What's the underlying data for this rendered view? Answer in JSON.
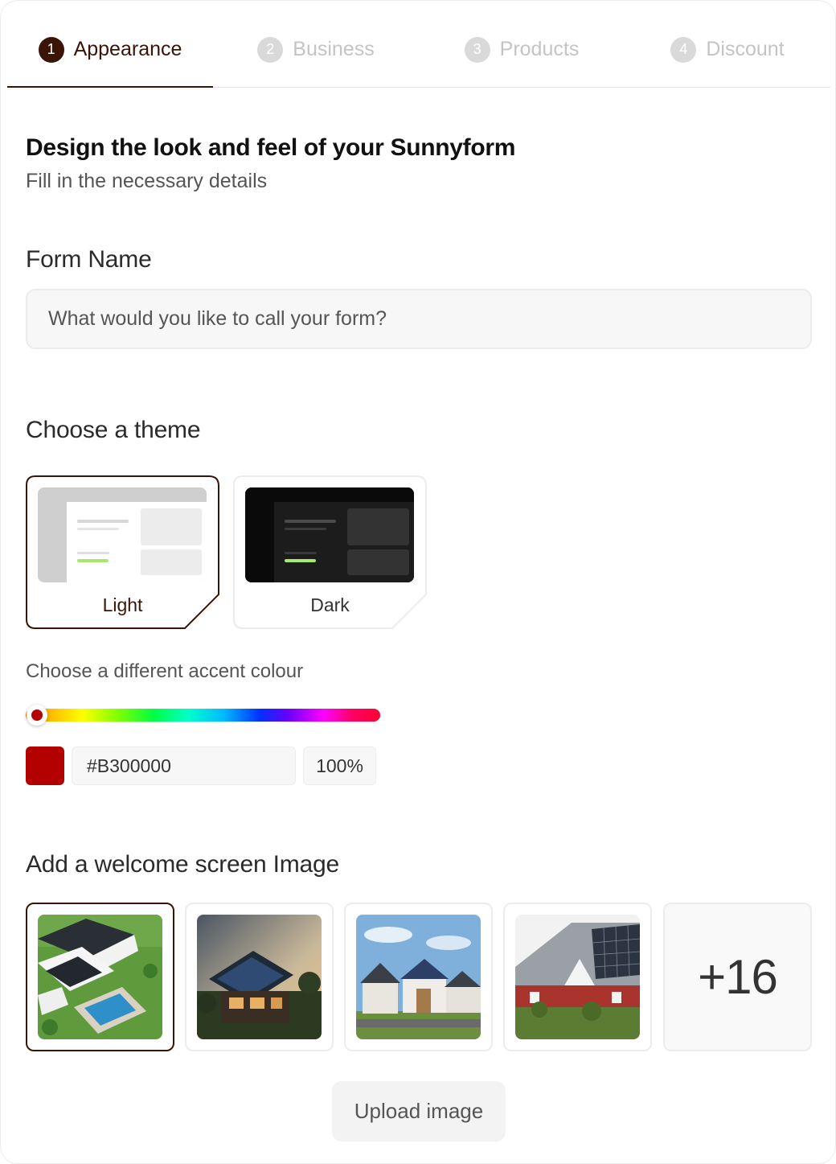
{
  "steps": [
    {
      "num": "1",
      "label": "Appearance"
    },
    {
      "num": "2",
      "label": "Business"
    },
    {
      "num": "3",
      "label": "Products"
    },
    {
      "num": "4",
      "label": "Discount"
    }
  ],
  "active_step": 1,
  "header": {
    "title": "Design the look and feel of your Sunnyform",
    "subtitle": "Fill in the necessary details"
  },
  "form_name": {
    "label": "Form Name",
    "value": "",
    "placeholder": "What would you like to call your form?"
  },
  "theme": {
    "label": "Choose a theme",
    "options": [
      "Light",
      "Dark"
    ],
    "selected": "Light"
  },
  "accent": {
    "label": "Choose a different accent colour",
    "hex": "#B300000",
    "opacity": "100%",
    "color": "#b30000",
    "hue_position": 0
  },
  "welcome_image": {
    "label": "Add a welcome screen Image",
    "thumbnails": [
      "aerial-house-with-pool",
      "house-solar-roof-evening",
      "houses-solar-roofs-street",
      "red-house-solar-panels"
    ],
    "selected_index": 0,
    "more_label": "+16",
    "upload_label": "Upload image"
  },
  "colors": {
    "brand_dark": "#3a1405",
    "light_accent_bar": "#a8e86b"
  }
}
